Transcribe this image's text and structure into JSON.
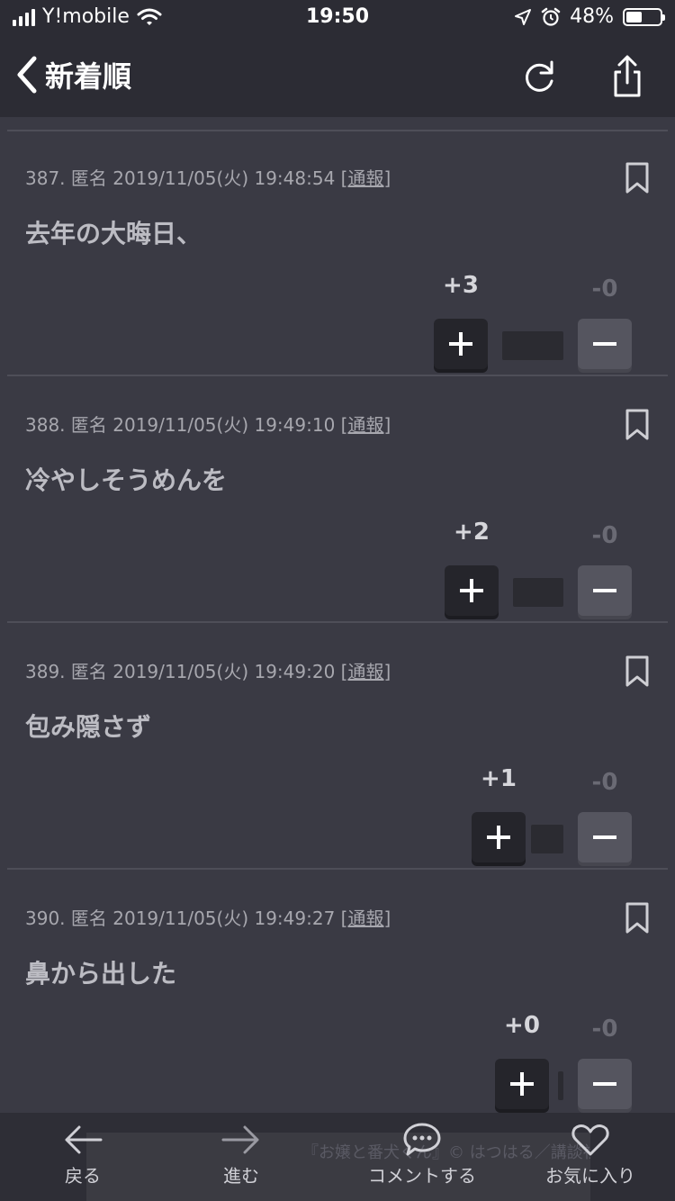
{
  "status_bar": {
    "carrier": "Y!mobile",
    "time": "19:50",
    "battery_pct": "48%",
    "battery_level": 0.48
  },
  "nav": {
    "back_label": "新着順",
    "reload_icon": "reload-icon",
    "share_icon": "share-icon"
  },
  "comments": [
    {
      "number": "387.",
      "author": "匿名",
      "datetime": "2019/11/05(火) 19:48:54",
      "report": "[通報]",
      "text": "去年の大晦日、",
      "plus": "+3",
      "minus": "-0"
    },
    {
      "number": "388.",
      "author": "匿名",
      "datetime": "2019/11/05(火) 19:49:10",
      "report": "[通報]",
      "text": "冷やしそうめんを",
      "plus": "+2",
      "minus": "-0"
    },
    {
      "number": "389.",
      "author": "匿名",
      "datetime": "2019/11/05(火) 19:49:20",
      "report": "[通報]",
      "text": "包み隠さず",
      "plus": "+1",
      "minus": "-0"
    },
    {
      "number": "390.",
      "author": "匿名",
      "datetime": "2019/11/05(火) 19:49:27",
      "report": "[通報]",
      "text": "鼻から出した",
      "plus": "+0",
      "minus": "-0"
    }
  ],
  "tabbar": {
    "back": "戻る",
    "forward": "進む",
    "comment": "コメントする",
    "favorite": "お気に入り",
    "banner_text": "『お嬢と番犬くん』© はつはる／講談社"
  },
  "colors": {
    "background": "#3a3a44",
    "bar": "#2c2c34",
    "plus_button": "#25252b",
    "minus_button": "#55555f"
  }
}
